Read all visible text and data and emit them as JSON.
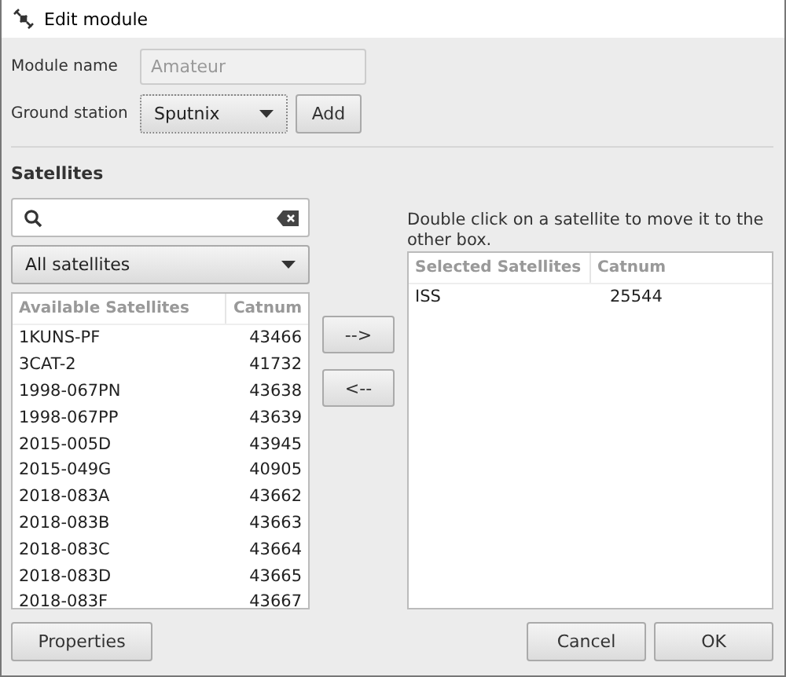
{
  "window": {
    "title": "Edit module"
  },
  "module_name": {
    "label": "Module name",
    "placeholder": "Amateur"
  },
  "ground_station": {
    "label": "Ground station",
    "value": "Sputnix",
    "add_button": "Add"
  },
  "section_title": "Satellites",
  "filter": {
    "value": "All satellites"
  },
  "available": {
    "columns": [
      "Available Satellites",
      "Catnum"
    ],
    "rows": [
      {
        "name": "1KUNS-PF",
        "catnum": "43466"
      },
      {
        "name": "3CAT-2",
        "catnum": "41732"
      },
      {
        "name": "1998-067PN",
        "catnum": "43638"
      },
      {
        "name": "1998-067PP",
        "catnum": "43639"
      },
      {
        "name": "2015-005D",
        "catnum": "43945"
      },
      {
        "name": "2015-049G",
        "catnum": "40905"
      },
      {
        "name": "2018-083A",
        "catnum": "43662"
      },
      {
        "name": "2018-083B",
        "catnum": "43663"
      },
      {
        "name": "2018-083C",
        "catnum": "43664"
      },
      {
        "name": "2018-083D",
        "catnum": "43665"
      },
      {
        "name": "2018-083F",
        "catnum": "43667"
      }
    ]
  },
  "move_buttons": [
    "-->",
    "<--"
  ],
  "hint": "Double click on a satellite to move it to the other box.",
  "selected": {
    "columns": [
      "Selected Satellites",
      "Catnum"
    ],
    "rows": [
      {
        "name": "ISS",
        "catnum": "25544"
      }
    ]
  },
  "buttons": {
    "left": "Properties",
    "right": [
      "Cancel",
      "OK"
    ]
  }
}
